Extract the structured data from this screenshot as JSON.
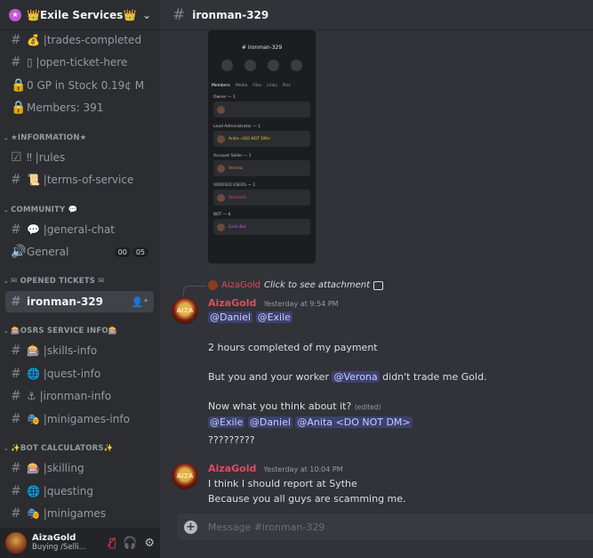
{
  "server": {
    "name": "👑Exile Services👑"
  },
  "sidebar": {
    "channels_top": [
      {
        "prefix": "💰 | ",
        "name": "trades-completed"
      },
      {
        "prefix": "▯ | ",
        "name": "open-ticket-here"
      },
      {
        "prefix": "",
        "name": "0 GP in Stock 0.19¢ M"
      },
      {
        "prefix": "",
        "name": "Members: 391"
      }
    ],
    "categories": {
      "information": "★INFORMATION★",
      "community": "COMMUNITY",
      "opened_tickets": "OPENED TICKETS",
      "osrs_info": "OSRS SERVICE INFO",
      "bot_calcs": "BOT CALCULATORS"
    },
    "info_channels": [
      {
        "prefix": "‼ | ",
        "name": "rules"
      },
      {
        "prefix": "📜 | ",
        "name": "terms-of-service"
      }
    ],
    "community_channels": [
      {
        "prefix": "💬 | ",
        "name": "general-chat"
      },
      {
        "prefix": "",
        "name": "General",
        "badges": [
          "00",
          "05"
        ]
      }
    ],
    "ticket_channels": [
      {
        "name": "ironman-329"
      }
    ],
    "osrs_channels": [
      {
        "prefix": "🎰 | ",
        "name": "skills-info"
      },
      {
        "prefix": "🌐 | ",
        "name": "quest-info"
      },
      {
        "prefix": "⚓ | ",
        "name": "ironman-info"
      },
      {
        "prefix": "🎭 | ",
        "name": "minigames-info"
      }
    ],
    "bot_channels": [
      {
        "prefix": "🎰 | ",
        "name": "skilling"
      },
      {
        "prefix": "🌐 | ",
        "name": "questing"
      },
      {
        "prefix": "🎭 | ",
        "name": "minigames"
      }
    ]
  },
  "user_panel": {
    "name": "AizaGold",
    "status": "Buying /Selli..."
  },
  "channel": {
    "name": "ironman-329"
  },
  "attachment_phone": {
    "title": "# ironman-329",
    "tabs": [
      "Members",
      "Media",
      "Files",
      "Links",
      "Pins"
    ],
    "sections": [
      {
        "title": "Owner — 1",
        "card": ""
      },
      {
        "title": "Lead Administrator — 1",
        "card": "Anita <DO NOT DM>"
      },
      {
        "title": "Account Seller — 1",
        "card": "Verona"
      },
      {
        "title": "VERIFIED USERS — 1",
        "card": "AizaGold"
      },
      {
        "title": "BOT — 6",
        "card": "Exile Bot"
      }
    ]
  },
  "reply": {
    "author": "AizaGold",
    "text": "Click to see attachment"
  },
  "messages": [
    {
      "author": "AizaGold",
      "time": "Yesterday at 9:54 PM",
      "mentions1": [
        "@Daniel",
        "@Exile"
      ],
      "line2": "2 hours completed of my payment",
      "line3_pre": "But you and your worker ",
      "line3_mention": "@Verona",
      "line3_post": " didn't trade me Gold.",
      "line4": "Now what you think about it?",
      "edited": "(edited)",
      "mentions2": [
        "@Exile",
        "@Daniel",
        "@Anita <DO NOT DM>"
      ],
      "line6": "?????????"
    },
    {
      "author": "AizaGold",
      "time": "Yesterday at 10:04 PM",
      "line1": "I think I should report at Sythe",
      "line2": "Because you all guys are scamming me."
    }
  ],
  "composer": {
    "placeholder": "Message #ironman-329"
  },
  "colors": {
    "accent": "#5865f2",
    "author": "#e04b5e",
    "sidebar": "#2b2d31",
    "main": "#313338"
  }
}
